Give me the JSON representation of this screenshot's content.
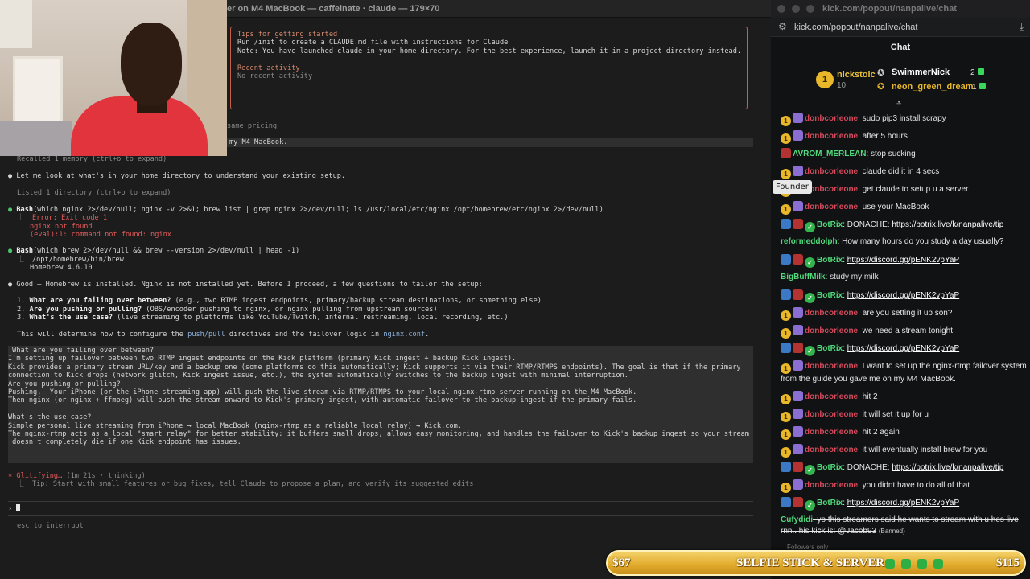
{
  "terminal": {
    "title": "er on M4 MacBook — caffeinate · claude — 179×70",
    "tips_heading": "Tips for getting started",
    "tip1": "Run /init to create a CLAUDE.md file with instructions for Claude",
    "tip2": "Note: You have launched claude in your home directory. For the best experience, launch it in a project directory instead.",
    "recent_heading": "Recent activity",
    "recent_value": "No recent activity",
    "same_pricing": "same pricing",
    "user_msg_tail": "my M4 MacBook.",
    "recalled": "Recalled 1 memory (ctrl+o to expand)",
    "look_home": "Let me look at what's in your home directory to understand your existing setup.",
    "listed": "Listed 1 directory (ctrl+o to expand)",
    "bash1_label": "Bash",
    "bash1_cmd": "(which nginx 2>/dev/null; nginx -v 2>&1; brew list | grep nginx 2>/dev/null; ls /usr/local/etc/nginx /opt/homebrew/etc/nginx 2>/dev/null)",
    "err1": "Error: Exit code 1",
    "err2": "nginx not found",
    "err3": "(eval):1: command not found: nginx",
    "bash2_label": "Bash",
    "bash2_cmd": "(which brew 2>/dev/null && brew --version 2>/dev/null | head -1)",
    "out1": "/opt/homebrew/bin/brew",
    "out2": "Homebrew 4.6.10",
    "good": "Good — Homebrew is installed. Nginx is not installed yet. Before I proceed, a few questions to tailor the setup:",
    "q1_bold": "What are you failing over between?",
    "q1_rest": " (e.g., two RTMP ingest endpoints, primary/backup stream destinations, or something else)",
    "q2_bold": "Are you pushing or pulling?",
    "q2_rest": " (OBS/encoder pushing to nginx, or nginx pulling from upstream sources)",
    "q3_bold": "What's the use case?",
    "q3_rest": " (live streaming to platforms like YouTube/Twitch, internal restreaming, local recording, etc.)",
    "determine_a": "This will determine how to configure the ",
    "determine_b": "push/pull",
    "determine_c": " directives and the failover logic in ",
    "determine_d": "nginx.conf",
    "determine_e": ".",
    "answer_lines": [
      " What are you failing over between?",
      "I'm setting up failover between two RTMP ingest endpoints on the Kick platform (primary Kick ingest + backup Kick ingest).",
      "Kick provides a primary stream URL/key and a backup one (some platforms do this automatically; Kick supports it via their RTMP/RTMPS endpoints). The goal is that if the primary",
      "connection to Kick drops (network glitch, Kick ingest issue, etc.), the system automatically switches to the backup ingest with minimal interruption.",
      "Are you pushing or pulling?",
      "Pushing.  Your iPhone (or the iPhone streaming app) will push the live stream via RTMP/RTMPS to your local nginx-rtmp server running on the M4 MacBook.",
      "Then nginx (or nginx + ffmpeg) will push the stream onward to Kick's primary ingest, with automatic failover to the backup ingest if the primary fails.",
      "",
      "What's the use case?",
      "Simple personal live streaming from iPhone → local MacBook (nginx-rtmp as a reliable local relay) → Kick.com.",
      "The nginx-rtmp acts as a local \"smart relay\" for better stability: it buffers small drops, allows easy monitoring, and handles the failover to Kick's backup ingest so your stream",
      " doesn't completely die if one Kick endpoint has issues."
    ],
    "status_word": "Glitifying…",
    "status_meta": " (1m 21s · thinking)",
    "status_tip": "Tip: Start with small features or bug fixes, tell Claude to propose a plan, and verify its suggested edits",
    "prompt": "›",
    "esc_hint": "esc to interrupt"
  },
  "chat": {
    "window_title": "kick.com/popout/nanpalive/chat",
    "url": "kick.com/popout/nanpalive/chat",
    "header": "Chat",
    "leaders": [
      {
        "name": "nickstoic",
        "sub": "10",
        "color": "#e9c23a"
      },
      {
        "name": "SwimmerNick",
        "count": "2",
        "color": "#ffffff"
      },
      {
        "name": "neon_green_dream",
        "count": "1",
        "color": "#e9b72a"
      }
    ],
    "founder_tooltip": "Founder",
    "messages": [
      {
        "user": "donbcorleone",
        "color": "#d44b5c",
        "text": ": sudo pip3 install scrapy",
        "badges": [
          "coin",
          "purple"
        ]
      },
      {
        "user": "donbcorleone",
        "color": "#d44b5c",
        "text": ": after 5 hours",
        "badges": [
          "coin",
          "purple"
        ]
      },
      {
        "user": "AVROM_MERLEAN",
        "color": "#51d97c",
        "text": ": stop sucking",
        "badges": [
          "red"
        ]
      },
      {
        "user": "donbcorleone",
        "color": "#d44b5c",
        "text": ": claude did it in 4 secs",
        "badges": [
          "coin",
          "purple"
        ]
      },
      {
        "user": "donbcorleone",
        "color": "#d44b5c",
        "text": ": get claude to setup u a server",
        "badges": [
          "coin",
          "purple"
        ]
      },
      {
        "user": "donbcorleone",
        "color": "#d44b5c",
        "text": ": use your MacBook",
        "badges": [
          "coin",
          "purple"
        ]
      },
      {
        "user": "BotRix",
        "color": "#51d97c",
        "text": ": DONACHE: ",
        "link": "https://botrix.live/k/nanpalive/tip",
        "badges": [
          "blue",
          "red",
          "green"
        ]
      },
      {
        "user": "reformeddolph",
        "color": "#51d97c",
        "text": ": How many hours do you study a day usually?",
        "badges": []
      },
      {
        "user": "BotRix",
        "color": "#51d97c",
        "text": ": ",
        "link": "https://discord.gg/pENK2vpYaP",
        "badges": [
          "blue",
          "red",
          "green"
        ]
      },
      {
        "user": "BigBuffMilk",
        "color": "#51d97c",
        "text": ": study my milk",
        "badges": []
      },
      {
        "user": "BotRix",
        "color": "#51d97c",
        "text": ": ",
        "link": "https://discord.gg/pENK2vpYaP",
        "badges": [
          "blue",
          "red",
          "green"
        ]
      },
      {
        "user": "donbcorleone",
        "color": "#d44b5c",
        "text": ": are you setting it up son?",
        "badges": [
          "coin",
          "purple"
        ]
      },
      {
        "user": "donbcorleone",
        "color": "#d44b5c",
        "text": ": we need a stream tonight",
        "badges": [
          "coin",
          "purple"
        ]
      },
      {
        "user": "BotRix",
        "color": "#51d97c",
        "text": ": ",
        "link": "https://discord.gg/pENK2vpYaP",
        "badges": [
          "blue",
          "red",
          "green"
        ]
      },
      {
        "user": "donbcorleone",
        "color": "#d44b5c",
        "text": ": I want to set up the nginx-rtmp failover system from the guide you gave me on my M4 MacBook.",
        "badges": [
          "coin",
          "purple"
        ]
      },
      {
        "user": "donbcorleone",
        "color": "#d44b5c",
        "text": ": hit 2",
        "badges": [
          "coin",
          "purple"
        ]
      },
      {
        "user": "donbcorleone",
        "color": "#d44b5c",
        "text": ": it will set it up for u",
        "badges": [
          "coin",
          "purple"
        ]
      },
      {
        "user": "donbcorleone",
        "color": "#d44b5c",
        "text": ": hit 2 again",
        "badges": [
          "coin",
          "purple"
        ]
      },
      {
        "user": "donbcorleone",
        "color": "#d44b5c",
        "text": ": it will eventually install brew for you",
        "badges": [
          "coin",
          "purple"
        ]
      },
      {
        "user": "BotRix",
        "color": "#51d97c",
        "text": ": DONACHE: ",
        "link": "https://botrix.live/k/nanpalive/tip",
        "badges": [
          "blue",
          "red",
          "green"
        ]
      },
      {
        "user": "donbcorleone",
        "color": "#d44b5c",
        "text": ": you didnt have to do all of that",
        "badges": [
          "coin",
          "purple"
        ]
      },
      {
        "user": "BotRix",
        "color": "#51d97c",
        "text": ": ",
        "link": "https://discord.gg/pENK2vpYaP",
        "badges": [
          "blue",
          "red",
          "green"
        ]
      },
      {
        "user": "Cufydidi",
        "color": "#51d97c",
        "text": ": yo this streamers said he wants to stream with u hes live rnn.. his kick is: @Jacob93",
        "badges": [],
        "banned": "(Banned)"
      }
    ],
    "footer": "Followers only"
  },
  "banner": {
    "left": "$67",
    "center": "SELFIE STICK & SERVER",
    "right": "$115"
  }
}
